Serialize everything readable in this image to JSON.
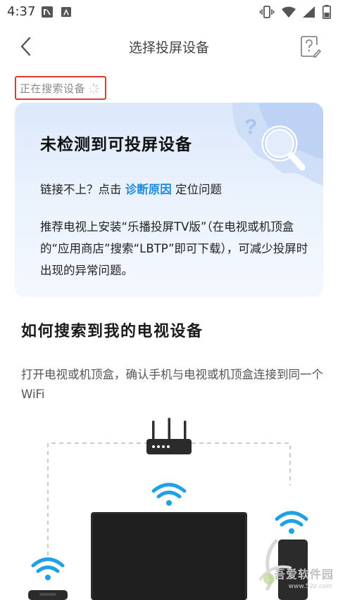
{
  "status_bar": {
    "time": "4:37",
    "left_icons": [
      "photo-icon",
      "notification-icon"
    ],
    "right_icons": [
      "vibrate-icon",
      "wifi-icon",
      "signal-icon",
      "battery-icon"
    ]
  },
  "nav": {
    "title": "选择投屏设备",
    "back_icon": "chevron-left-icon",
    "help_icon": "help-icon"
  },
  "search_status": {
    "label": "正在搜索设备",
    "icon": "spinner-icon"
  },
  "notice_card": {
    "title": "未检测到可投屏设备",
    "prefix": "链接不上？点击 ",
    "link": "诊断原因",
    "suffix": " 定位问题",
    "recommendation": "推荐电视上安装“乐播投屏TV版”（在电视或机顶盒的“应用商店”搜索“LBTP”即可下载），可减少投屏时出现的异常问题。",
    "accent_color": "#1f8ce0"
  },
  "how_to": {
    "title": "如何搜索到我的电视设备",
    "description": "打开电视或机顶盒，确认手机与电视或机顶盒连接到同一个WiFi"
  },
  "watermark": {
    "text": "吾爱软件园",
    "site": "www.52z.com"
  }
}
